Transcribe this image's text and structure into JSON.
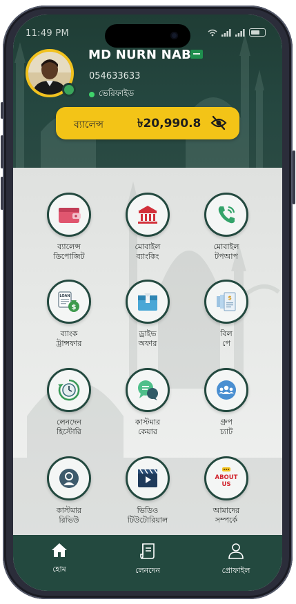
{
  "status_bar": {
    "time": "11:49 PM"
  },
  "profile": {
    "name": "MD NURN NABI",
    "phone": "054633633",
    "verified_label": "ভেরিফাইড",
    "online": true
  },
  "balance": {
    "label": "ব্যালেন্স",
    "value": "৳20,990.8",
    "visibility_icon": "eye-off-icon"
  },
  "menu": [
    {
      "label_line1": "ব্যালেন্স",
      "label_line2": "ডিপোজিট",
      "icon": "wallet-icon"
    },
    {
      "label_line1": "মোবাইল",
      "label_line2": "ব্যাংকিং",
      "icon": "bank-icon"
    },
    {
      "label_line1": "মোবাইল",
      "label_line2": "টপআপ",
      "icon": "phone-call-icon"
    },
    {
      "label_line1": "ব্যাংক",
      "label_line2": "ট্রান্সফার",
      "icon": "loan-money-bag-icon"
    },
    {
      "label_line1": "ড্রাইভ",
      "label_line2": "অফার",
      "icon": "gift-box-icon"
    },
    {
      "label_line1": "বিল",
      "label_line2": "পে",
      "icon": "bill-receipt-icon"
    },
    {
      "label_line1": "লেনদেন",
      "label_line2": "হিস্টোরি",
      "icon": "history-clock-icon"
    },
    {
      "label_line1": "কাস্টমার",
      "label_line2": "কেয়ার",
      "icon": "chat-bubbles-icon"
    },
    {
      "label_line1": "গ্রুপ",
      "label_line2": "চ্যাট",
      "icon": "group-chat-icon"
    },
    {
      "label_line1": "কাস্টমার",
      "label_line2": "রিভিউ",
      "icon": "user-profile-icon"
    },
    {
      "label_line1": "ভিডিও",
      "label_line2": "টিউটোরিয়াল",
      "icon": "video-play-icon"
    },
    {
      "label_line1": "আমাদের",
      "label_line2": "সম্পর্কে",
      "icon": "about-us-icon",
      "badge_text": "ABOUT US"
    }
  ],
  "tabbar": {
    "home": "হোম",
    "transactions": "লেনদেন",
    "profile": "প্রোফাইল"
  },
  "colors": {
    "header_bg": "#1f3d35",
    "accent_yellow": "#f3c417",
    "tile_border": "#23493f",
    "tabbar_bg": "#23493f"
  }
}
